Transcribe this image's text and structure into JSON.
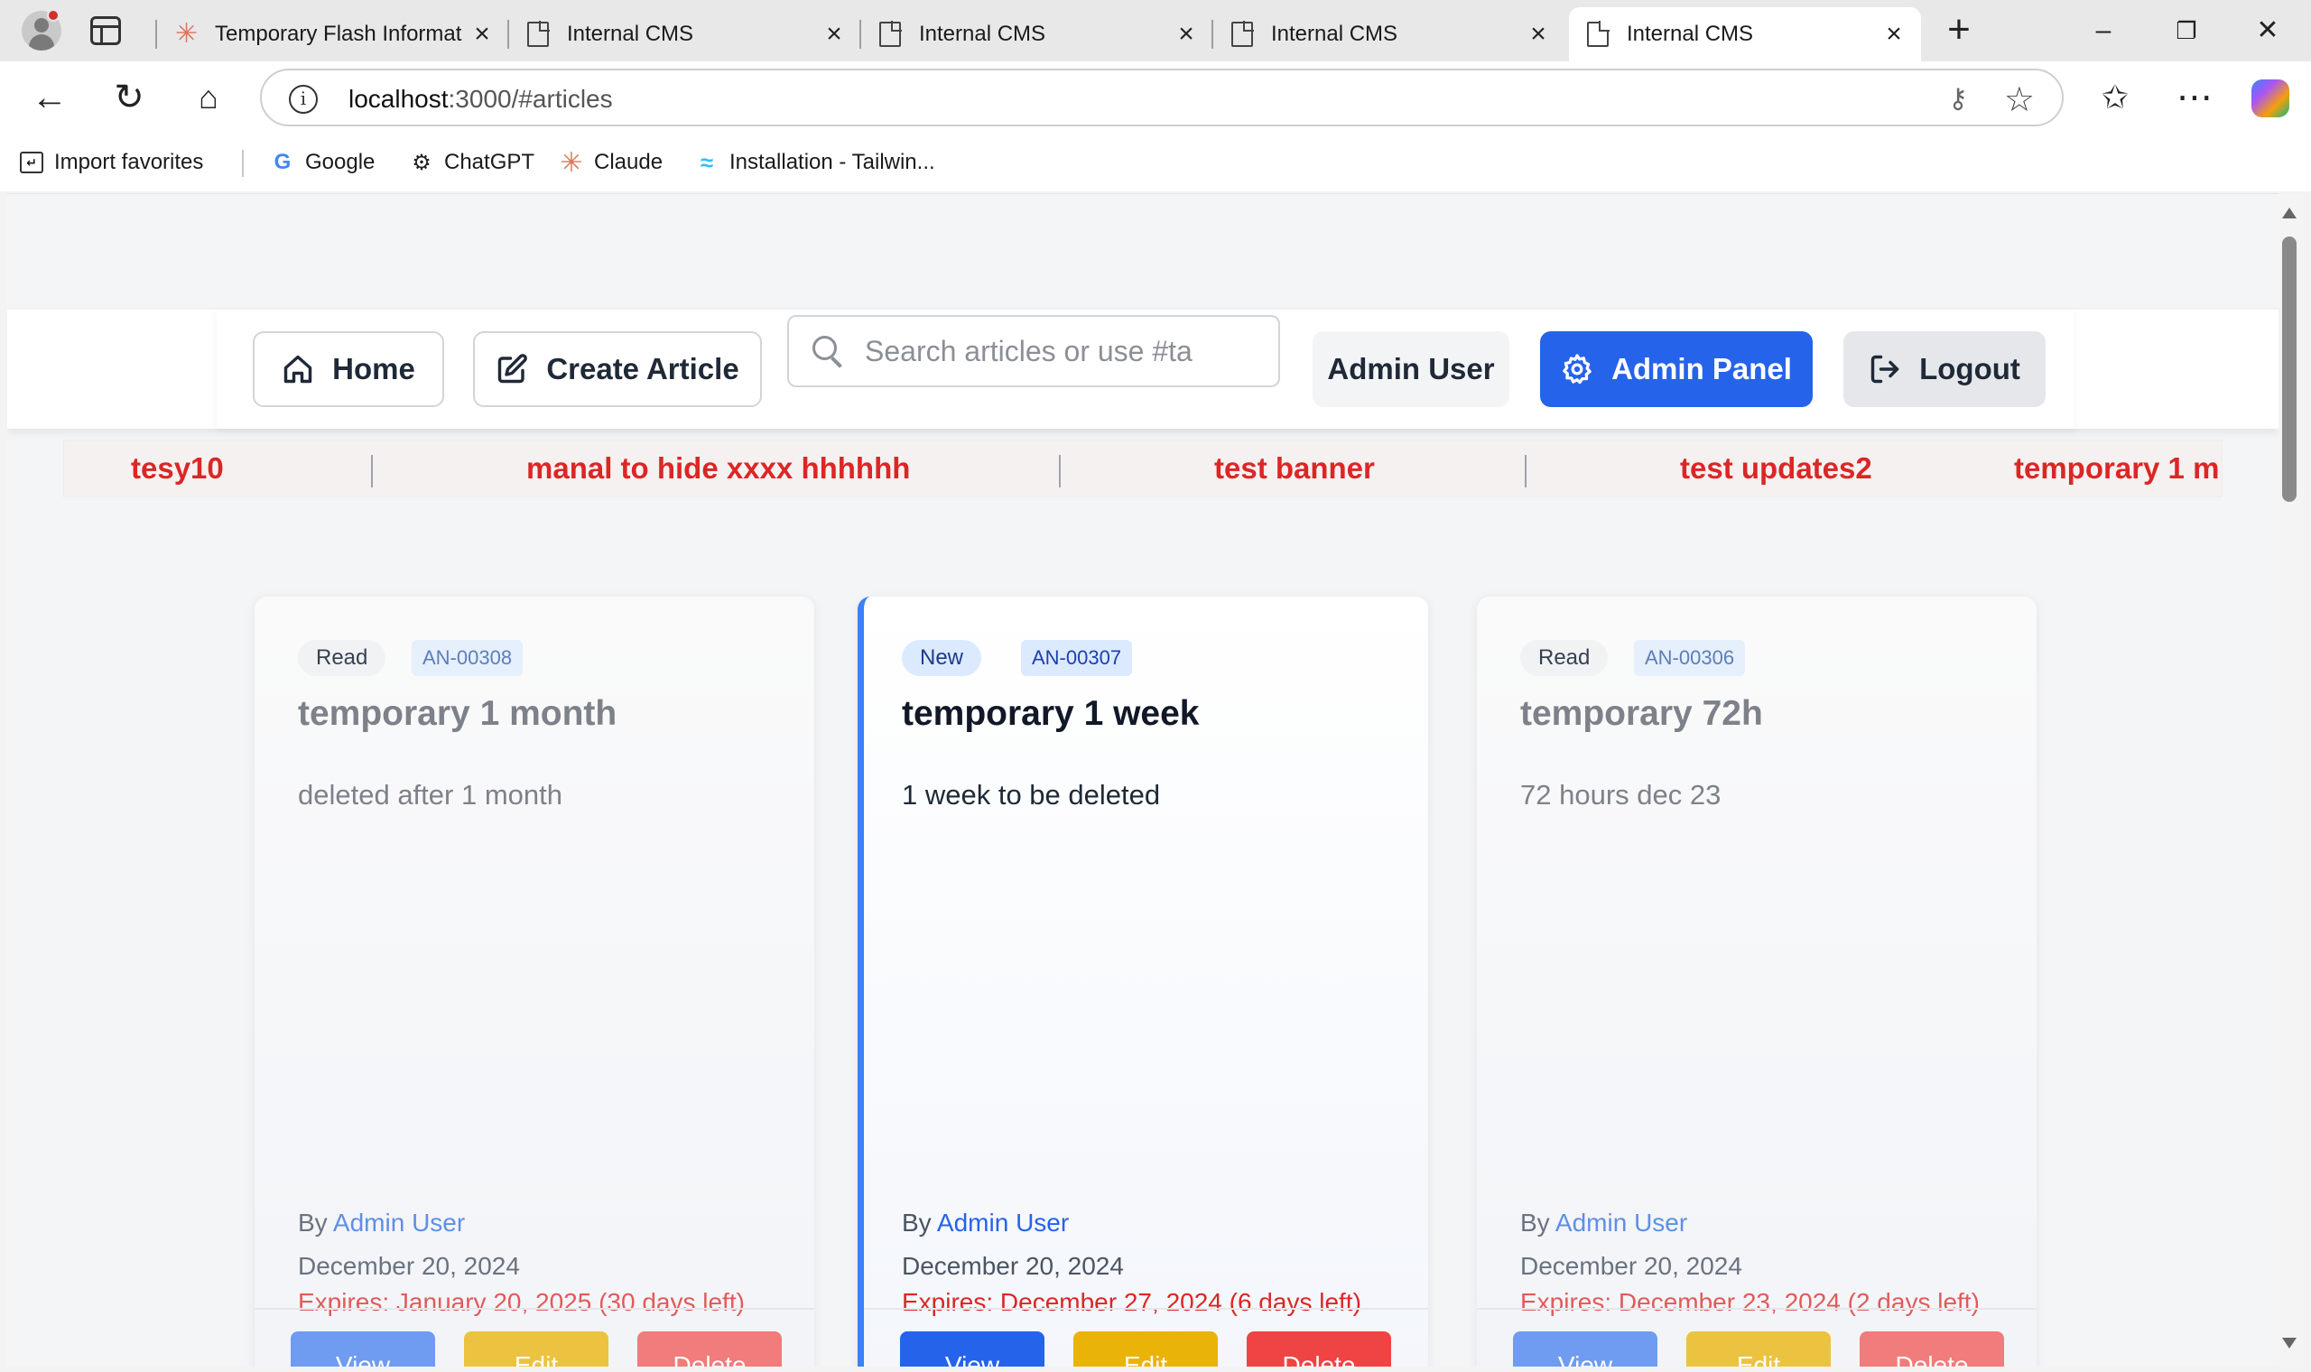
{
  "browser": {
    "tabs": [
      {
        "title": "Temporary Flash Informat",
        "icon": "claude-spark-icon",
        "active": false
      },
      {
        "title": "Internal CMS",
        "icon": "document-icon",
        "active": false
      },
      {
        "title": "Internal CMS",
        "icon": "document-icon",
        "active": false
      },
      {
        "title": "Internal CMS",
        "icon": "document-icon",
        "active": false
      },
      {
        "title": "Internal CMS",
        "icon": "document-icon",
        "active": true
      }
    ],
    "url_host": "localhost",
    "url_path": ":3000/#articles",
    "bookmarks": [
      {
        "label": "Import favorites",
        "icon": "import-icon"
      },
      {
        "label": "Google",
        "icon": "google-icon"
      },
      {
        "label": "ChatGPT",
        "icon": "chatgpt-icon"
      },
      {
        "label": "Claude",
        "icon": "claude-icon"
      },
      {
        "label": "Installation - Tailwin...",
        "icon": "tailwind-icon"
      }
    ]
  },
  "header": {
    "home_label": "Home",
    "create_label": "Create Article",
    "search_placeholder": "Search articles or use #ta",
    "user_label": "Admin User",
    "admin_label": "Admin Panel",
    "logout_label": "Logout"
  },
  "ticker": {
    "items": [
      "tesy10",
      "manal to hide xxxx hhhhhh",
      "test banner",
      "test updates2",
      "temporary 1 m"
    ],
    "color": "#dc2626"
  },
  "articles": [
    {
      "status": "Read",
      "code": "AN-00308",
      "title": "temporary 1 month",
      "description": "deleted after 1 month",
      "by_prefix": "By",
      "author": "Admin User",
      "date": "December 20, 2024",
      "expires": "Expires: January 20, 2025 (30 days left)",
      "view_label": "View",
      "edit_label": "Edit",
      "delete_label": "Delete"
    },
    {
      "status": "New",
      "code": "AN-00307",
      "title": "temporary 1 week",
      "description": "1 week to be deleted",
      "by_prefix": "By",
      "author": "Admin User",
      "date": "December 20, 2024",
      "expires": "Expires: December 27, 2024 (6 days left)",
      "view_label": "View",
      "edit_label": "Edit",
      "delete_label": "Delete"
    },
    {
      "status": "Read",
      "code": "AN-00306",
      "title": "temporary 72h",
      "description": "72 hours dec 23",
      "by_prefix": "By",
      "author": "Admin User",
      "date": "December 20, 2024",
      "expires": "Expires: December 23, 2024 (2 days left)",
      "view_label": "View",
      "edit_label": "Edit",
      "delete_label": "Delete"
    }
  ],
  "colors": {
    "primary": "#2563eb",
    "edit": "#eab308",
    "delete": "#ef4444",
    "expiry": "#dc2626"
  }
}
